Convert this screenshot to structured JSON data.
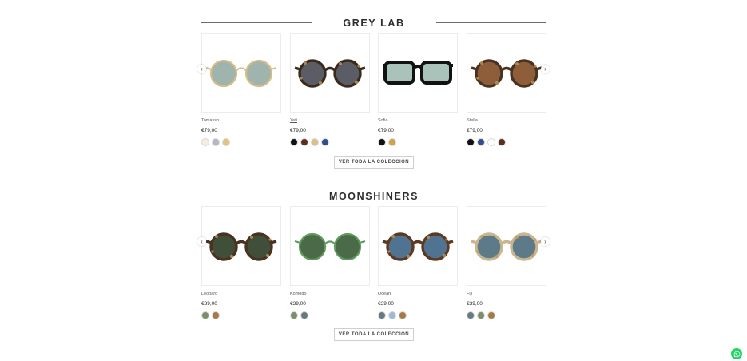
{
  "sections": [
    {
      "title": "GREY LAB",
      "products": [
        {
          "name": "Tomasso",
          "price": "€79,00",
          "frame_color": "#d8bd86",
          "lens_color": "#9fb4ad",
          "frame_style": "round-thin",
          "swatches": [
            "#f4ede0",
            "#b6b6c6",
            "#e2c27c"
          ]
        },
        {
          "name": "Yeti",
          "price": "€79,00",
          "frame_color": "#3b2a1b",
          "lens_color": "#5a5c66",
          "frame_style": "round-tortoise",
          "swatches": [
            "#111111",
            "#5b2f1c",
            "#dcc08a",
            "#2f4f8f"
          ]
        },
        {
          "name": "Sofia",
          "price": "€79,00",
          "frame_color": "#121212",
          "lens_color": "#a9c3ba",
          "frame_style": "square-thick",
          "swatches": [
            "#111111",
            "#d3a14a"
          ]
        },
        {
          "name": "Stella",
          "price": "€79,00",
          "frame_color": "#4a3221",
          "lens_color": "#8e5e3b",
          "frame_style": "round-tortoise",
          "swatches": [
            "#111111",
            "#2f4f8f",
            "#ffffff",
            "#5b2f1c"
          ]
        }
      ],
      "button_label": "VER TODA LA COLECCIÓN"
    },
    {
      "title": "MOONSHINERS",
      "products": [
        {
          "name": "Leopard",
          "price": "€39,00",
          "frame_color": "#4a3221",
          "lens_color": "#3f4f3a",
          "frame_style": "round-tortoise",
          "swatches": [
            "#7a8e6a",
            "#a77a45"
          ]
        },
        {
          "name": "Komodo",
          "price": "€39,00",
          "frame_color": "#5f9b5c",
          "lens_color": "#4b6a48",
          "frame_style": "round-thin",
          "swatches": [
            "#7a8e6a",
            "#667a7e"
          ]
        },
        {
          "name": "Ocean",
          "price": "€39,00",
          "frame_color": "#5c3a22",
          "lens_color": "#4f7390",
          "frame_style": "round-tortoise",
          "swatches": [
            "#667a86",
            "#9dbad6",
            "#a77a45"
          ]
        },
        {
          "name": "Fiji",
          "price": "€39,00",
          "frame_color": "#c9b58f",
          "lens_color": "#5c7a88",
          "frame_style": "round-tortoise",
          "swatches": [
            "#667a86",
            "#7a8e6a",
            "#a77a45"
          ]
        }
      ],
      "button_label": "VER TODA LA COLECCIÓN"
    }
  ],
  "nav_prev_icon": "chevron-left-icon",
  "nav_next_icon": "chevron-right-icon",
  "floating_icon": "whatsapp-icon",
  "brand_colors": {
    "whatsapp": "#25d366",
    "divider": "#6c6c6c"
  }
}
